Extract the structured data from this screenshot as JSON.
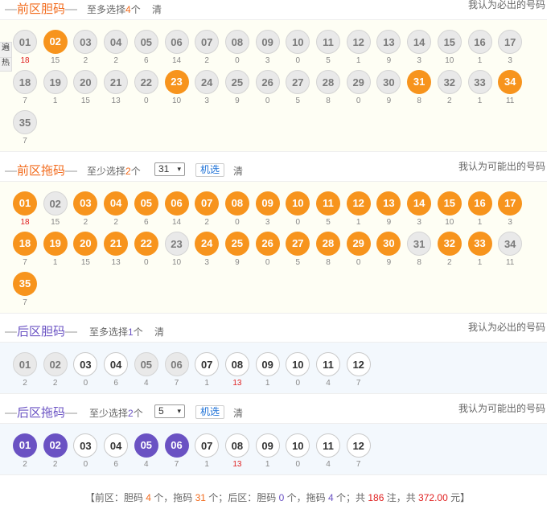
{
  "front_dan": {
    "title_name": "前区胆码",
    "hint_prefix": "至多选择",
    "hint_num": "4",
    "hint_suffix": "个",
    "clear_label": "清",
    "right_note": "我认为必出的号码",
    "side_tab_top": "遍",
    "side_tab_bottom": "热",
    "balls": [
      "01",
      "02",
      "03",
      "04",
      "05",
      "06",
      "07",
      "08",
      "09",
      "10",
      "11",
      "12",
      "13",
      "14",
      "15",
      "16",
      "17",
      "18",
      "19",
      "20",
      "21",
      "22",
      "23",
      "24",
      "25",
      "26",
      "27",
      "28",
      "29",
      "30",
      "31",
      "32",
      "33",
      "34",
      "35"
    ],
    "states": [
      "gray",
      "orange",
      "gray",
      "gray",
      "gray",
      "gray",
      "gray",
      "gray",
      "gray",
      "gray",
      "gray",
      "gray",
      "gray",
      "gray",
      "gray",
      "gray",
      "gray",
      "gray",
      "gray",
      "gray",
      "gray",
      "gray",
      "orange",
      "gray",
      "gray",
      "gray",
      "gray",
      "gray",
      "gray",
      "gray",
      "orange",
      "gray",
      "gray",
      "orange",
      "gray"
    ],
    "misses": [
      "18",
      "15",
      "2",
      "2",
      "6",
      "14",
      "2",
      "0",
      "3",
      "0",
      "5",
      "1",
      "9",
      "3",
      "10",
      "1",
      "3",
      "7",
      "1",
      "15",
      "13",
      "0",
      "10",
      "3",
      "9",
      "0",
      "5",
      "8",
      "0",
      "9",
      "8",
      "2",
      "1",
      "11",
      "7"
    ],
    "hot_index": 0
  },
  "front_tuo": {
    "title_name": "前区拖码",
    "hint_prefix": "至少选择",
    "hint_num": "2",
    "hint_suffix": "个",
    "select_value": "31",
    "random_label": "机选",
    "clear_label": "清",
    "right_note": "我认为可能出的号码",
    "balls": [
      "01",
      "02",
      "03",
      "04",
      "05",
      "06",
      "07",
      "08",
      "09",
      "10",
      "11",
      "12",
      "13",
      "14",
      "15",
      "16",
      "17",
      "18",
      "19",
      "20",
      "21",
      "22",
      "23",
      "24",
      "25",
      "26",
      "27",
      "28",
      "29",
      "30",
      "31",
      "32",
      "33",
      "34",
      "35"
    ],
    "states": [
      "orange",
      "gray",
      "orange",
      "orange",
      "orange",
      "orange",
      "orange",
      "orange",
      "orange",
      "orange",
      "orange",
      "orange",
      "orange",
      "orange",
      "orange",
      "orange",
      "orange",
      "orange",
      "orange",
      "orange",
      "orange",
      "orange",
      "gray",
      "orange",
      "orange",
      "orange",
      "orange",
      "orange",
      "orange",
      "orange",
      "gray",
      "orange",
      "orange",
      "gray",
      "orange"
    ],
    "misses": [
      "18",
      "15",
      "2",
      "2",
      "6",
      "14",
      "2",
      "0",
      "3",
      "0",
      "5",
      "1",
      "9",
      "3",
      "10",
      "1",
      "3",
      "7",
      "1",
      "15",
      "13",
      "0",
      "10",
      "3",
      "9",
      "0",
      "5",
      "8",
      "0",
      "9",
      "8",
      "2",
      "1",
      "11",
      "7"
    ],
    "hot_index": 0
  },
  "back_dan": {
    "title_name": "后区胆码",
    "hint_prefix": "至多选择",
    "hint_num": "1",
    "hint_suffix": "个",
    "clear_label": "清",
    "right_note": "我认为必出的号码",
    "balls": [
      "01",
      "02",
      "03",
      "04",
      "05",
      "06",
      "07",
      "08",
      "09",
      "10",
      "11",
      "12"
    ],
    "states": [
      "gray",
      "gray",
      "white",
      "white",
      "gray",
      "gray",
      "white",
      "white",
      "white",
      "white",
      "white",
      "white"
    ],
    "misses": [
      "2",
      "2",
      "0",
      "6",
      "4",
      "7",
      "1",
      "13",
      "1",
      "0",
      "4",
      "7"
    ],
    "hot_index": 7
  },
  "back_tuo": {
    "title_name": "后区拖码",
    "hint_prefix": "至少选择",
    "hint_num": "2",
    "hint_suffix": "个",
    "select_value": "5",
    "random_label": "机选",
    "clear_label": "清",
    "right_note": "我认为可能出的号码",
    "balls": [
      "01",
      "02",
      "03",
      "04",
      "05",
      "06",
      "07",
      "08",
      "09",
      "10",
      "11",
      "12"
    ],
    "states": [
      "purple",
      "purple",
      "white",
      "white",
      "purple",
      "purple",
      "white",
      "white",
      "white",
      "white",
      "white",
      "white"
    ],
    "misses": [
      "2",
      "2",
      "0",
      "6",
      "4",
      "7",
      "1",
      "13",
      "1",
      "0",
      "4",
      "7"
    ],
    "hot_index": 7
  },
  "summary": {
    "p1": "【前区：胆码 ",
    "front_dan_count": "4",
    "p2": " 个，拖码 ",
    "front_tuo_count": "31",
    "p3": " 个；后区：胆码 ",
    "back_dan_count": "0",
    "p4": " 个，拖码 ",
    "back_tuo_count": "4",
    "p5": " 个；共 ",
    "bets": "186",
    "p6": " 注，共 ",
    "amount": "372.00",
    "p7": " 元】"
  },
  "dash": "—",
  "select_arrow": "▾",
  "colors": {
    "orange": "#f7941d",
    "purple": "#6a52c3",
    "front_title": "#f26a1b",
    "hot_red": "#e02020"
  }
}
